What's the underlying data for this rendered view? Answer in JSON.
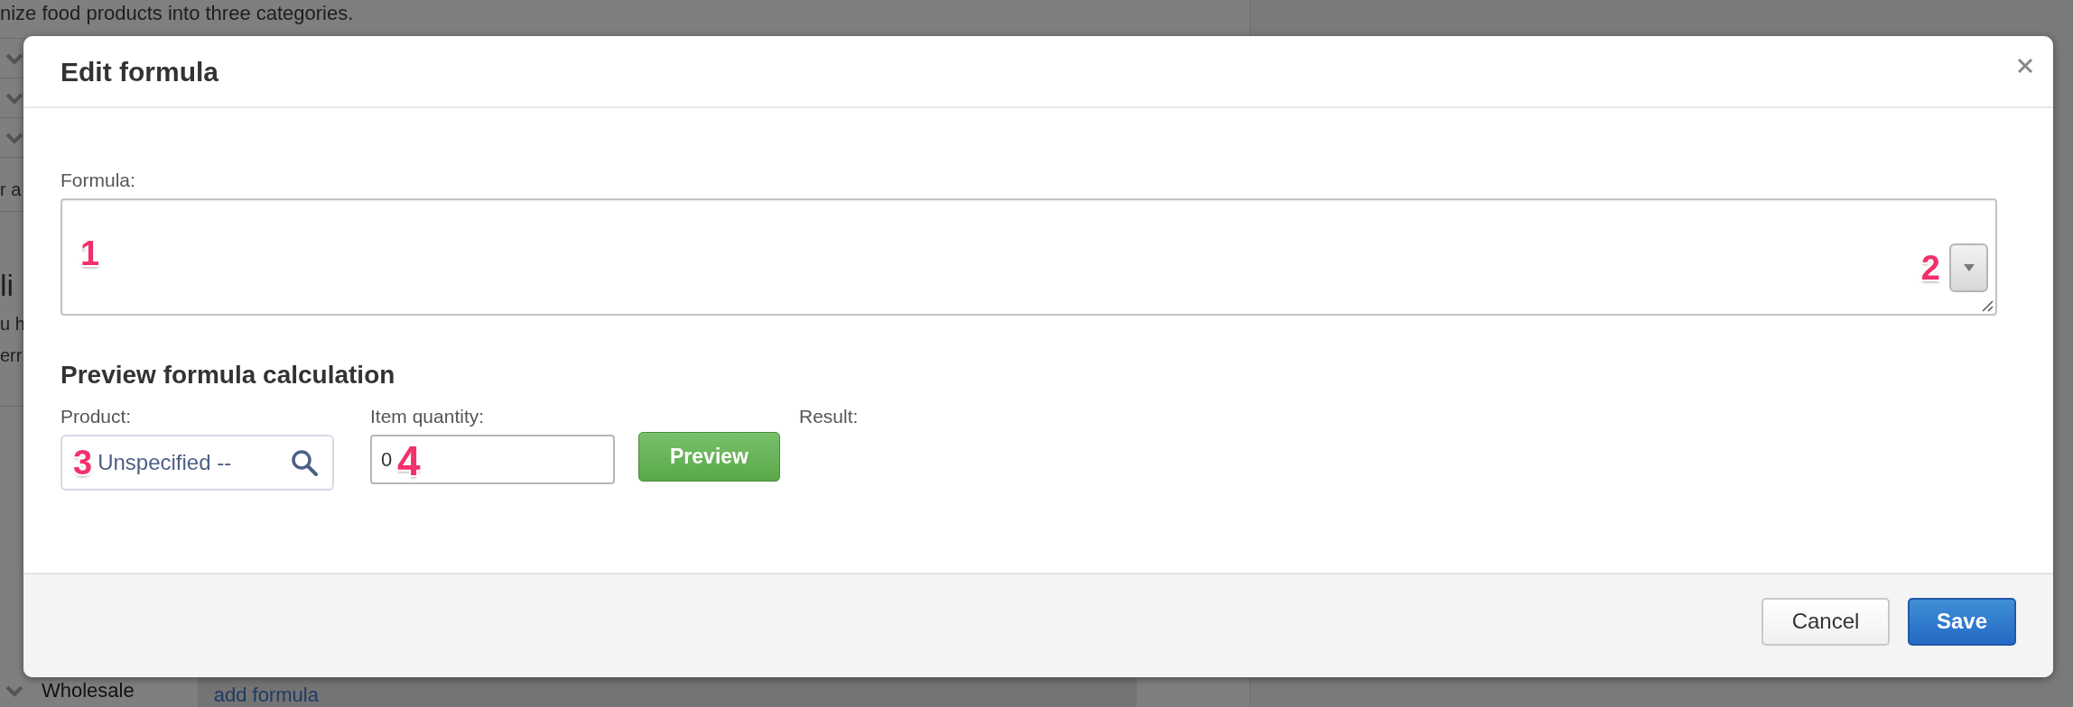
{
  "background_page": {
    "intro_text": "nize food products into three categories.",
    "fragments": [
      "r a",
      "li",
      "u h",
      "err"
    ],
    "bottom_row": {
      "name": "Wholesale",
      "link": "add formula"
    }
  },
  "dialog": {
    "title": "Edit formula",
    "formula": {
      "label": "Formula:",
      "badge": "1",
      "menu_button": {
        "badge": "2"
      }
    },
    "preview": {
      "heading": "Preview formula calculation",
      "product": {
        "label": "Product:",
        "value": "Unspecified --",
        "badge": "3"
      },
      "quantity": {
        "label": "Item quantity:",
        "value": "0",
        "badge": "4"
      },
      "preview_button": "Preview",
      "result": {
        "label": "Result:"
      }
    },
    "buttons": [
      {
        "label": "Cancel",
        "kind": "secondary"
      },
      {
        "label": "Save",
        "kind": "primary"
      }
    ]
  }
}
